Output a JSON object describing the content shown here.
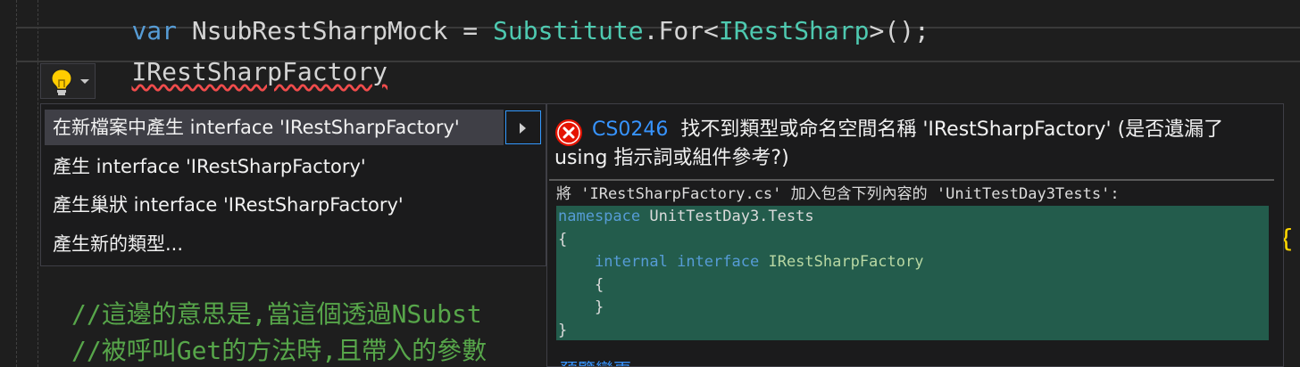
{
  "editor": {
    "line1": {
      "kw": "var",
      "name": "NsubRestSharpMock",
      "op": " = ",
      "cls": "Substitute",
      "dot": ".",
      "method": "For",
      "generic_open": "<",
      "generic_type": "IRestSharp",
      "generic_close": ">();"
    },
    "line2_text": "IRestSharpFactory",
    "comment1": "//這邊的意思是,當這個透過NSubst",
    "comment2": "//被呼叫Get的方法時,且帶入的參數",
    "brace_fragment": "{'"
  },
  "lightbulb": {
    "icon": "lightbulb-icon",
    "dropdown_icon": "chevron-down-icon"
  },
  "quick_actions": {
    "items": [
      {
        "label": "在新檔案中產生 interface 'IRestSharpFactory'"
      },
      {
        "label": "產生 interface 'IRestSharpFactory'"
      },
      {
        "label": "產生巢狀 interface 'IRestSharpFactory'"
      },
      {
        "label": "產生新的類型..."
      }
    ],
    "submenu_icon": "chevron-right-icon"
  },
  "preview": {
    "error_icon": "error-icon",
    "error_code": "CS0246",
    "error_text_1": "找不到類型或命名空間名稱 'IRestSharpFactory' (是否遺漏了",
    "error_text_2": "using 指示詞或組件參考?)",
    "add_line": "將 'IRestSharpFactory.cs' 加入包含下列內容的 'UnitTestDay3Tests':",
    "code": {
      "ns_kw": "namespace",
      "ns_name": " UnitTestDay3.Tests",
      "open_brace": "{",
      "internal_kw": "internal",
      "interface_kw": "interface",
      "iface_name": "IRestSharpFactory",
      "inner_open": "{",
      "inner_close": "}",
      "close_brace": "}"
    },
    "link": "預覽變更"
  },
  "colors": {
    "accent": "#3794ff",
    "error": "#e51400",
    "diff_bg": "#235c4c",
    "comment": "#57a64a"
  }
}
